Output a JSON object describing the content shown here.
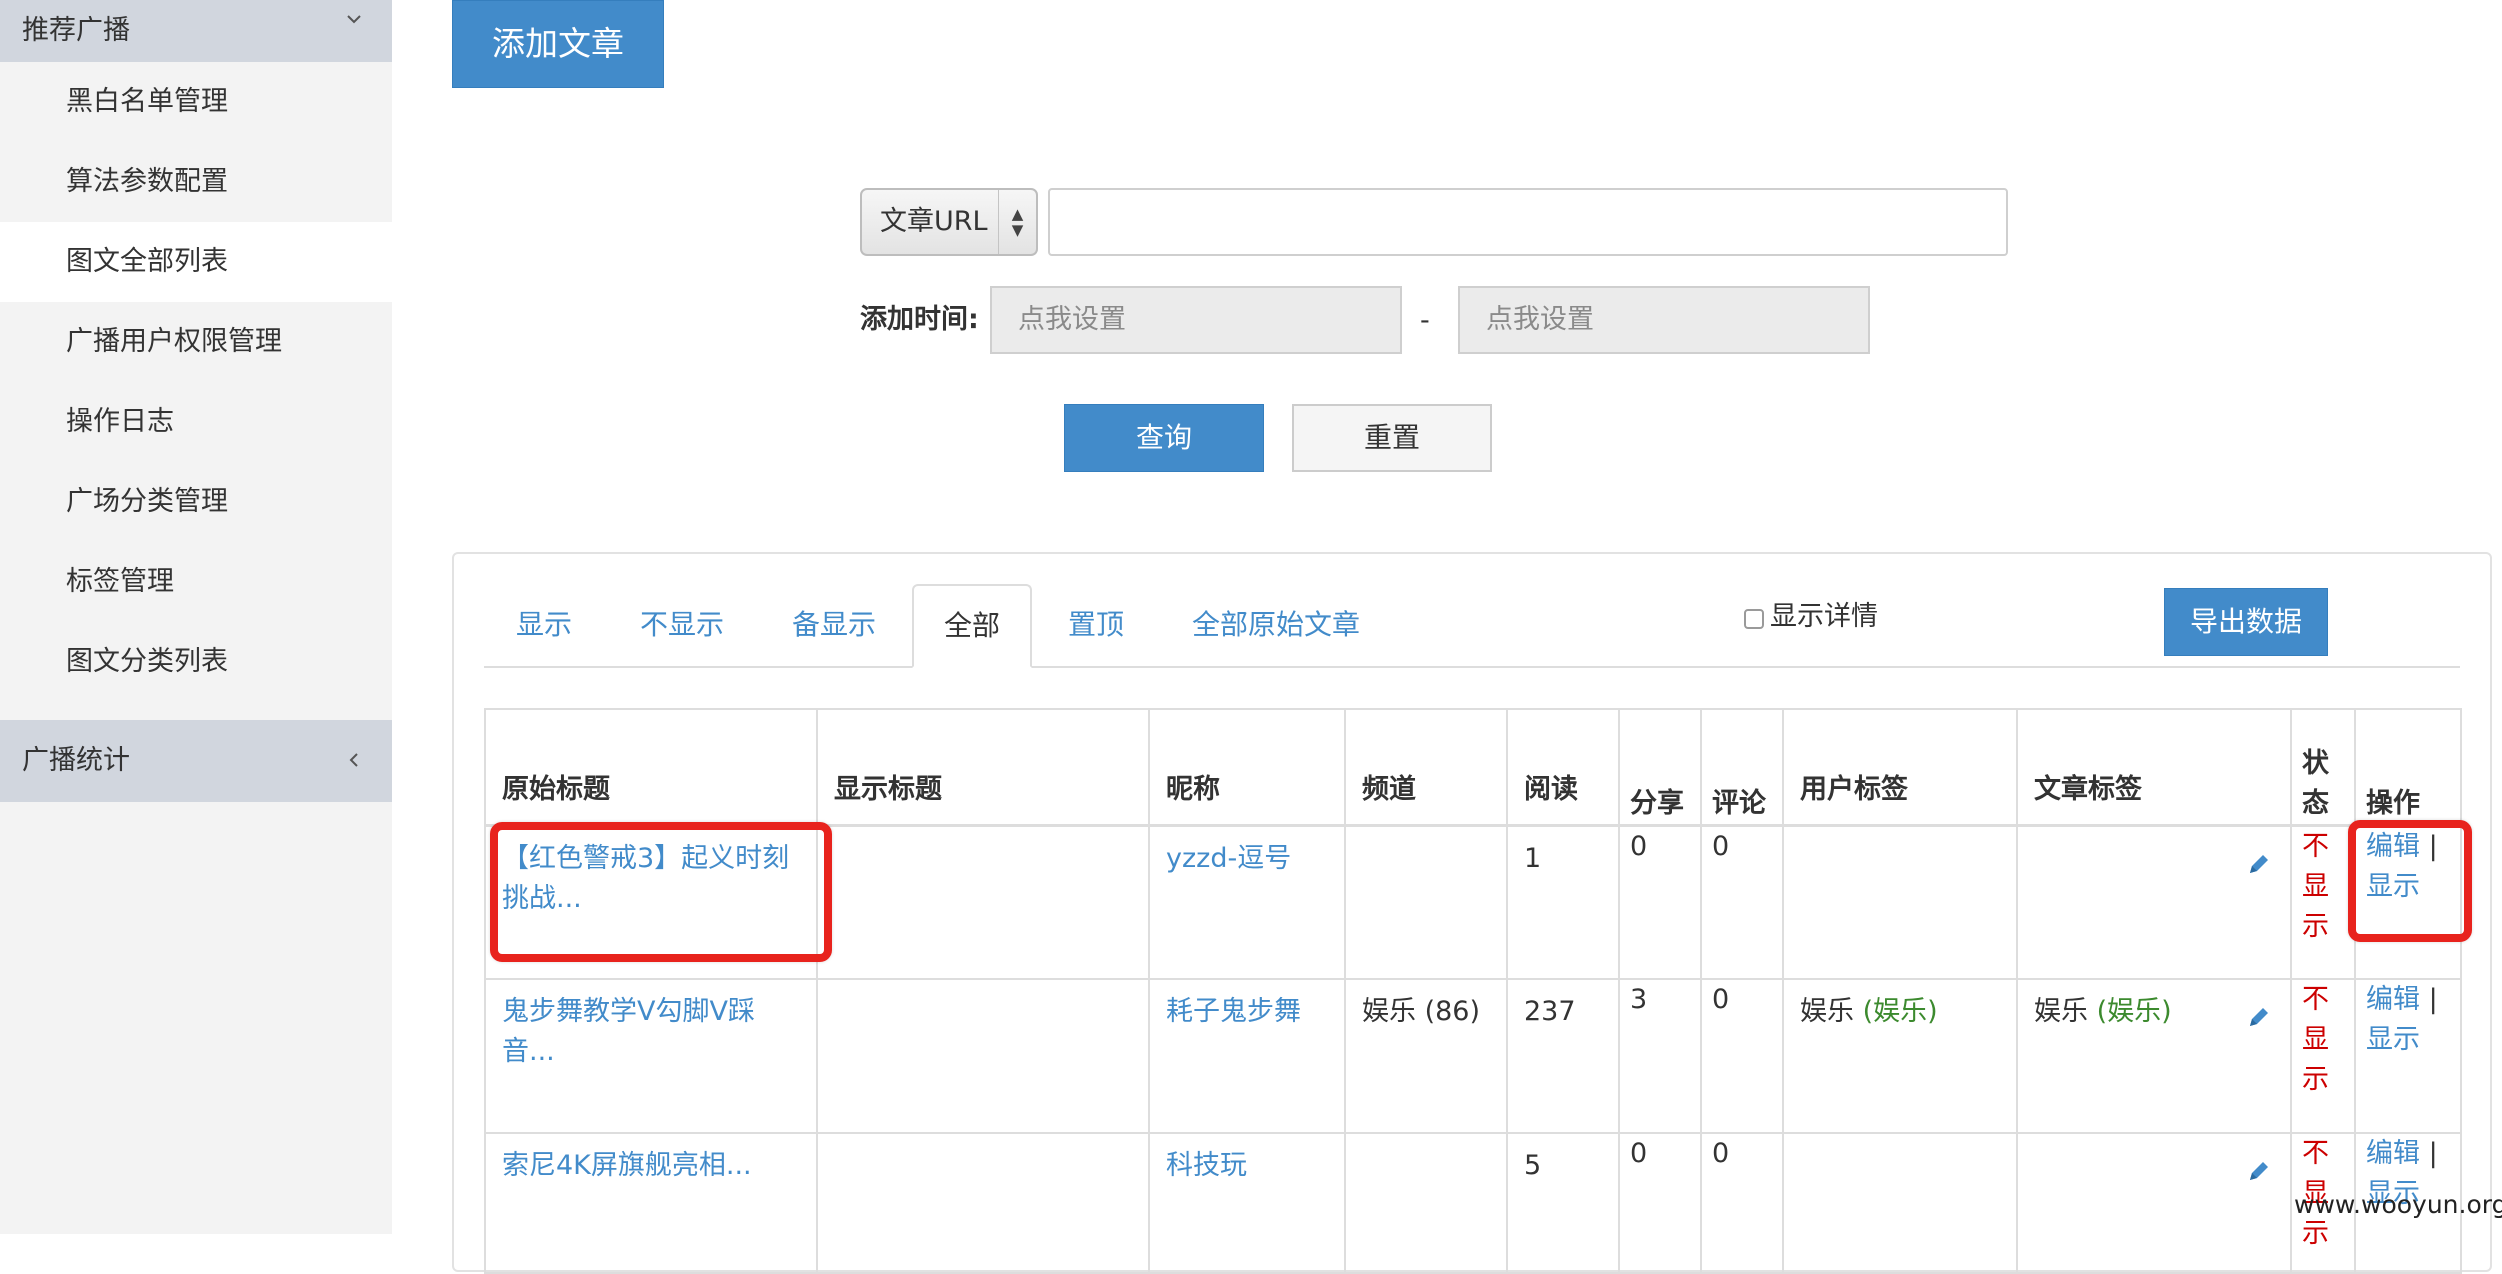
{
  "sidebar": {
    "group1": "推荐广播",
    "items": [
      {
        "label": "黑白名单管理"
      },
      {
        "label": "算法参数配置"
      },
      {
        "label": "图文全部列表"
      },
      {
        "label": "广播用户权限管理"
      },
      {
        "label": "操作日志"
      },
      {
        "label": "广场分类管理"
      },
      {
        "label": "标签管理"
      },
      {
        "label": "图文分类列表"
      }
    ],
    "active_item": "图文全部列表",
    "group2": "广播统计"
  },
  "toolbar": {
    "add_article_label": "添加文章"
  },
  "search": {
    "url_select_value": "文章URL",
    "url_input_value": "",
    "time_label": "添加时间:",
    "start_placeholder": "点我设置",
    "dash": "-",
    "end_placeholder": "点我设置",
    "query_label": "查询",
    "reset_label": "重置"
  },
  "tabs": [
    {
      "label": "显示"
    },
    {
      "label": "不显示"
    },
    {
      "label": "备显示"
    },
    {
      "label": "全部"
    },
    {
      "label": "置顶"
    },
    {
      "label": "全部原始文章"
    }
  ],
  "active_tab": "全部",
  "detail_label": "显示详情",
  "export_label": "导出数据",
  "table": {
    "headers": [
      "原始标题",
      "显示标题",
      "昵称",
      "频道",
      "阅读",
      "分享",
      "评论",
      "用户标签",
      "文章标签",
      "状态",
      "操作"
    ],
    "rows": [
      {
        "orig_title": "【红色警戒3】起义时刻挑战...",
        "show_title": "",
        "nick": "yzzd-逗号",
        "channel": "",
        "read": "1",
        "share": "0",
        "comment": "0",
        "user_tag": "",
        "user_tag_extra": "",
        "article_tag": "",
        "article_tag_extra": "",
        "status": "不显示",
        "op_edit": "编辑",
        "op_sep": "|",
        "op_show": "显示"
      },
      {
        "orig_title": "鬼步舞教学V勾脚V踩音...",
        "show_title": "",
        "nick": "耗子鬼步舞",
        "channel": "娱乐 (86)",
        "read": "237",
        "share": "3",
        "comment": "0",
        "user_tag": "娱乐 ",
        "user_tag_extra": "(娱乐)",
        "article_tag": "娱乐 ",
        "article_tag_extra": "(娱乐)",
        "status": "不显示",
        "op_edit": "编辑",
        "op_sep": "|",
        "op_show": "显示"
      },
      {
        "orig_title": "索尼4K屏旗舰亮相...",
        "show_title": "",
        "nick": "科技玩",
        "channel": "",
        "read": "5",
        "share": "0",
        "comment": "0",
        "user_tag": "",
        "user_tag_extra": "",
        "article_tag": "",
        "article_tag_extra": "",
        "status": "不显示",
        "op_edit": "编辑",
        "op_sep": "|",
        "op_show": "显示"
      }
    ]
  },
  "watermark": "www.wooyun.org",
  "colors": {
    "primary": "#428bca",
    "status_red": "#cc0000",
    "tag_green": "#3c8a2e",
    "highlight": "#e8231d",
    "sidebar_head": "#d1d6de"
  }
}
